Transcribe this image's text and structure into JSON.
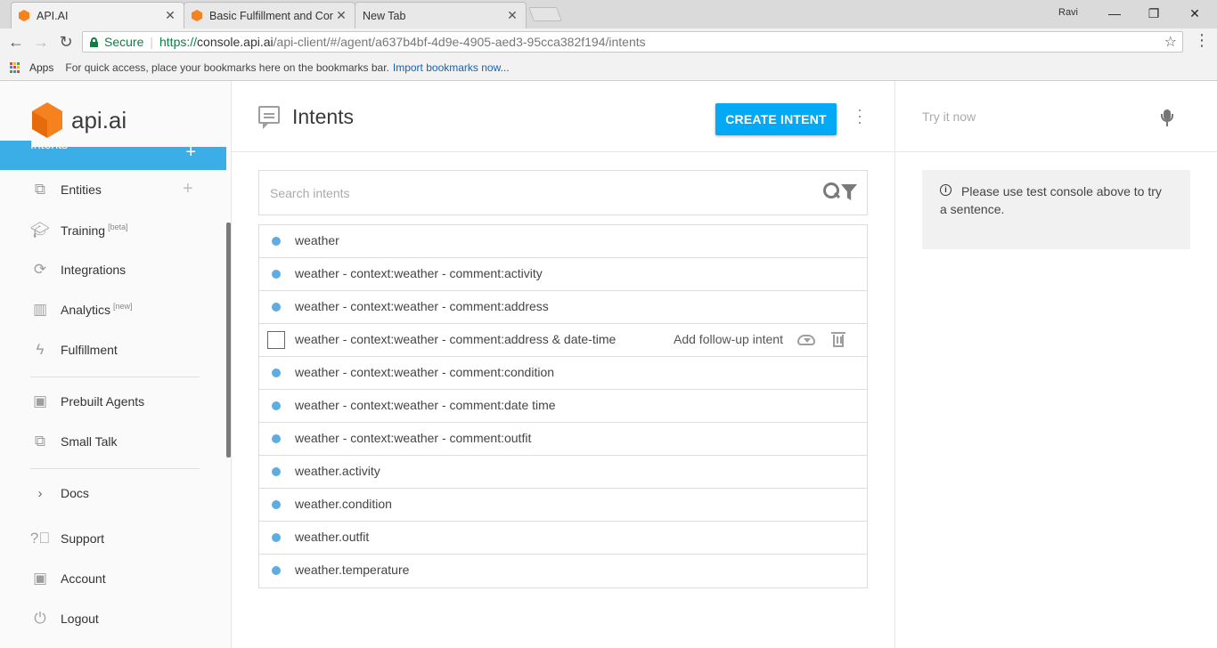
{
  "browser": {
    "tabs": [
      {
        "title": "API.AI",
        "active": true
      },
      {
        "title": "Basic Fulfillment and Cor",
        "active": false
      },
      {
        "title": "New Tab",
        "active": false
      }
    ],
    "user": "Ravi",
    "window_controls": {
      "minimize": "—",
      "restore": "❐",
      "close": "✕"
    },
    "nav": {
      "back": "←",
      "forward": "→",
      "reload": "↻"
    },
    "address": {
      "secure_label": "Secure",
      "protocol": "https://",
      "host": "console.api.ai",
      "path": "/api-client/#/agent/a637b4bf-4d9e-4905-aed3-95cca382f194/intents"
    },
    "bookmarks_bar": {
      "apps_label": "Apps",
      "hint_text": "For quick access, place your bookmarks here on the bookmarks bar.",
      "import_link": "Import bookmarks now..."
    }
  },
  "sidebar": {
    "logo_text": "api.ai",
    "active_item": {
      "label": "Intents",
      "icon": "intents-icon"
    },
    "items": [
      {
        "label": "Entities",
        "icon": "entities-icon",
        "badge": "",
        "has_add": true
      },
      {
        "label": "Training",
        "icon": "training-icon",
        "badge": "[beta]",
        "has_add": false
      },
      {
        "label": "Integrations",
        "icon": "integrations-icon",
        "badge": "",
        "has_add": false
      },
      {
        "label": "Analytics",
        "icon": "analytics-icon",
        "badge": "[new]",
        "has_add": false
      },
      {
        "label": "Fulfillment",
        "icon": "fulfillment-icon",
        "badge": "",
        "has_add": false
      },
      {
        "label": "Prebuilt Agents",
        "icon": "prebuilt-agents-icon",
        "badge": "",
        "has_add": false
      },
      {
        "label": "Small Talk",
        "icon": "small-talk-icon",
        "badge": "",
        "has_add": false
      },
      {
        "label": "Docs",
        "icon": "chevron-right-icon",
        "badge": "",
        "has_add": false
      },
      {
        "label": "Support",
        "icon": "help-icon",
        "badge": "",
        "has_add": false
      },
      {
        "label": "Account",
        "icon": "account-icon",
        "badge": "",
        "has_add": false
      },
      {
        "label": "Logout",
        "icon": "power-icon",
        "badge": "",
        "has_add": false
      }
    ]
  },
  "main": {
    "title": "Intents",
    "create_button": "CREATE INTENT",
    "search_placeholder": "Search intents",
    "hover_actions": {
      "add_followup": "Add follow-up intent"
    },
    "intents": [
      {
        "name": "weather",
        "hovered": false
      },
      {
        "name": "weather - context:weather - comment:activity",
        "hovered": false
      },
      {
        "name": "weather - context:weather - comment:address",
        "hovered": false
      },
      {
        "name": "weather - context:weather - comment:address & date-time",
        "hovered": true
      },
      {
        "name": "weather - context:weather - comment:condition",
        "hovered": false
      },
      {
        "name": "weather - context:weather - comment:date time",
        "hovered": false
      },
      {
        "name": "weather - context:weather - comment:outfit",
        "hovered": false
      },
      {
        "name": "weather.activity",
        "hovered": false
      },
      {
        "name": "weather.condition",
        "hovered": false
      },
      {
        "name": "weather.outfit",
        "hovered": false
      },
      {
        "name": "weather.temperature",
        "hovered": false
      }
    ]
  },
  "test_console": {
    "placeholder": "Try it now",
    "info_text": "Please use test console above to try a sentence."
  },
  "colors": {
    "accent": "#03a9f4",
    "active_nav": "#3baee7",
    "intent_dot": "#5dade2",
    "logo": "#f5821f"
  }
}
